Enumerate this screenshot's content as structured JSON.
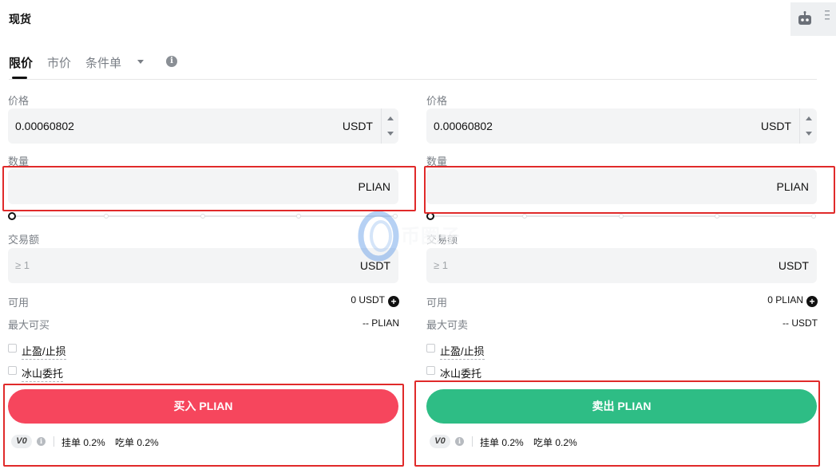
{
  "header": {
    "title": "现货"
  },
  "order_tabs": [
    {
      "label": "限价",
      "active": true
    },
    {
      "label": "市价",
      "active": false
    },
    {
      "label": "条件单",
      "active": false
    }
  ],
  "buy": {
    "price_label": "价格",
    "price_value": "0.00060802",
    "price_unit": "USDT",
    "qty_label": "数量",
    "qty_unit": "PLIAN",
    "amount_label": "交易额",
    "amount_placeholder": "≥ 1",
    "amount_unit": "USDT",
    "avail_label": "可用",
    "avail_value": "0 USDT",
    "max_label": "最大可买",
    "max_value": "-- PLIAN",
    "tpsl_label": "止盈/止损",
    "iceberg_label": "冰山委托",
    "button_label": "买入 PLIAN",
    "vip_label": "V0",
    "maker_fee": "挂单 0.2%",
    "taker_fee": "吃单 0.2%"
  },
  "sell": {
    "price_label": "价格",
    "price_value": "0.00060802",
    "price_unit": "USDT",
    "qty_label": "数量",
    "qty_unit": "PLIAN",
    "amount_label": "交易额",
    "amount_placeholder": "≥ 1",
    "amount_unit": "USDT",
    "avail_label": "可用",
    "avail_value": "0 PLIAN",
    "max_label": "最大可卖",
    "max_value": "-- USDT",
    "tpsl_label": "止盈/止损",
    "iceberg_label": "冰山委托",
    "button_label": "卖出 PLIAN",
    "vip_label": "V0",
    "maker_fee": "挂单 0.2%",
    "taker_fee": "吃单 0.2%"
  },
  "watermark": {
    "text": "币圈子"
  },
  "colors": {
    "buy": "#f6465d",
    "sell": "#2ebd85",
    "highlight": "#e02a2a"
  }
}
